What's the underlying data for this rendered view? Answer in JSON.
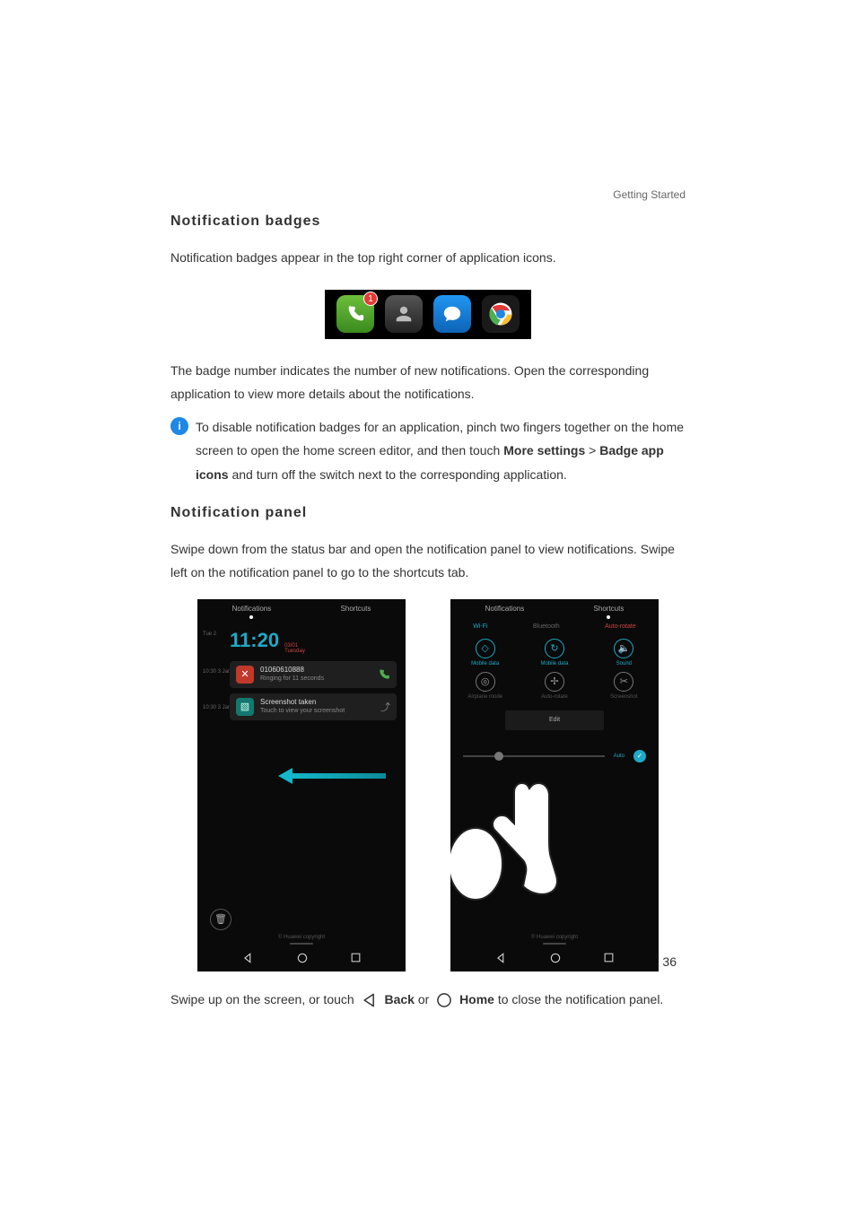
{
  "header": {
    "section": "Getting Started"
  },
  "sec1": {
    "title": "Notification badges",
    "p1": "Notification badges appear in the top right corner of application icons.",
    "p2": "The badge number indicates the number of new notifications. Open the corresponding application to view more details about the notifications.",
    "info_a": "To disable notification badges for an application, pinch two fingers together on the home screen to open the home screen editor, and then touch ",
    "more_settings": "More settings",
    "gt": " > ",
    "badge_icons": "Badge app icons",
    "info_b": " and turn off the switch next to the corresponding application.",
    "badge_count": "1"
  },
  "sec2": {
    "title": "Notification panel",
    "p1": "Swipe down from the status bar and open the notification panel to view notifications. Swipe left on the notification panel to go to the shortcuts tab.",
    "close_a": "Swipe up on the screen, or touch ",
    "back": "Back",
    "or": " or ",
    "home": "Home",
    "close_b": " to close the notification panel."
  },
  "mock_left": {
    "tab1": "Notifications",
    "tab2": "Shortcuts",
    "side1": "Tue 2",
    "side2": "10:30 3 Jan",
    "side3": "10:30 3 Jan",
    "time": "11:20",
    "date_top": "03/01",
    "date_bot": "Tuesday",
    "card1_title": "01060610888",
    "card1_sub": "Ringing for 11 seconds",
    "card2_title": "Screenshot taken",
    "card2_sub": "Touch to view your screenshot",
    "footer": "© Huawei copyright"
  },
  "mock_right": {
    "tab1": "Notifications",
    "tab2": "Shortcuts",
    "top1": "Wi-Fi",
    "top2": "Bluetooth",
    "top3": "Auto-rotate",
    "cells": [
      {
        "lbl": "Mobile data",
        "cls": "on",
        "glyph": "◇"
      },
      {
        "lbl": "Mobile data",
        "cls": "on",
        "glyph": "↻"
      },
      {
        "lbl": "Sound",
        "cls": "on",
        "glyph": "🔈"
      },
      {
        "lbl": "Airplane mode",
        "cls": "mut",
        "glyph": "◎"
      },
      {
        "lbl": "Auto-rotate",
        "cls": "mut",
        "glyph": "✢"
      },
      {
        "lbl": "Screenshot",
        "cls": "mut",
        "glyph": "✂"
      }
    ],
    "edit": "Edit",
    "auto": "Auto",
    "footer": "© Huawei copyright"
  },
  "page_number": "36"
}
